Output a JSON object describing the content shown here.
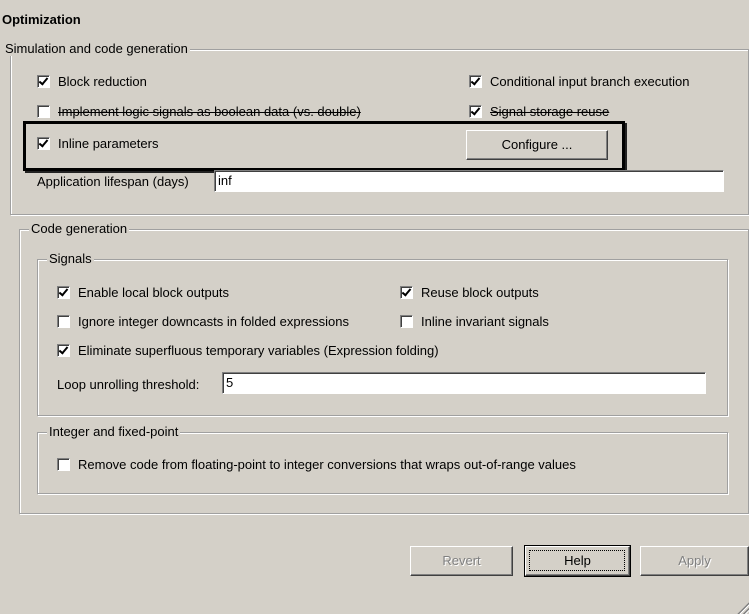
{
  "title": "Optimization",
  "sim_group": {
    "legend": "Simulation and code generation",
    "block_reduction": {
      "label": "Block reduction",
      "checked": true
    },
    "conditional_input": {
      "label": "Conditional input branch execution",
      "checked": true
    },
    "implement_logic": {
      "label": "Implement logic signals as boolean data (vs. double)",
      "checked": false
    },
    "signal_storage": {
      "label": "Signal storage reuse",
      "checked": true
    },
    "inline_params": {
      "label": "Inline parameters",
      "checked": true
    },
    "configure_label": "Configure ...",
    "lifespan_label": "Application lifespan (days)",
    "lifespan_value": "inf"
  },
  "code_group": {
    "legend": "Code generation",
    "signals": {
      "legend": "Signals",
      "enable_local": {
        "label": "Enable local block outputs",
        "checked": true
      },
      "reuse_block": {
        "label": "Reuse block outputs",
        "checked": true
      },
      "ignore_integer": {
        "label": "Ignore integer downcasts in folded expressions",
        "checked": false
      },
      "inline_invariant": {
        "label": "Inline invariant signals",
        "checked": false
      },
      "eliminate": {
        "label": "Eliminate superfluous temporary variables (Expression folding)",
        "checked": true
      },
      "loop_label": "Loop unrolling threshold:",
      "loop_value": "5"
    },
    "integer": {
      "legend": "Integer and fixed-point",
      "remove_code": {
        "label": "Remove code from floating-point to integer conversions that wraps out-of-range values",
        "checked": false
      }
    }
  },
  "buttons": {
    "revert": "Revert",
    "help": "Help",
    "apply": "Apply"
  }
}
